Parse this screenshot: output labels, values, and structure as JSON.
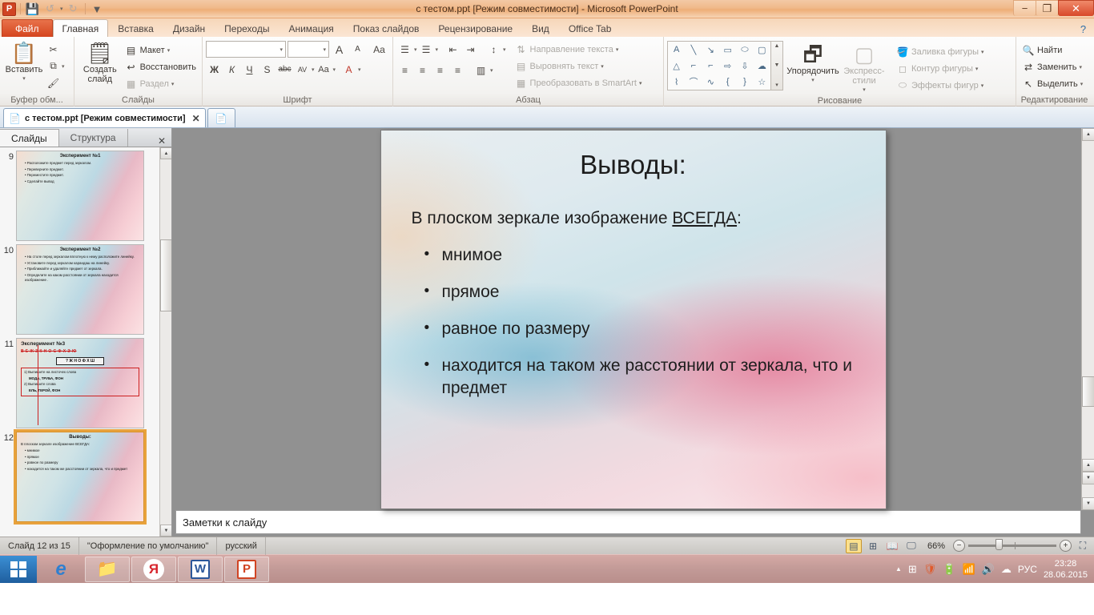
{
  "window": {
    "title": "с тестом.ppt [Режим совместимости]  -  Microsoft PowerPoint",
    "app_icon": "P",
    "minimize": "−",
    "restore": "❐",
    "close": "✕",
    "help": "?"
  },
  "quick_access": {
    "save": "💾",
    "undo": "↺",
    "redo": "↻",
    "customize": "▼"
  },
  "ribbon_tabs": [
    {
      "label": "Файл",
      "type": "file"
    },
    {
      "label": "Главная",
      "type": "active"
    },
    {
      "label": "Вставка",
      "type": "normal"
    },
    {
      "label": "Дизайн",
      "type": "normal"
    },
    {
      "label": "Переходы",
      "type": "normal"
    },
    {
      "label": "Анимация",
      "type": "normal"
    },
    {
      "label": "Показ слайдов",
      "type": "normal"
    },
    {
      "label": "Рецензирование",
      "type": "normal"
    },
    {
      "label": "Вид",
      "type": "normal"
    },
    {
      "label": "Office Tab",
      "type": "normal"
    }
  ],
  "ribbon": {
    "clipboard": {
      "label": "Буфер обм...",
      "paste": "Вставить",
      "cut_icon": "✂",
      "copy_icon": "⧉",
      "format_painter_icon": "🖌"
    },
    "slides": {
      "label": "Слайды",
      "new_slide": "Создать слайд",
      "layout": "Макет",
      "reset": "Восстановить",
      "section": "Раздел"
    },
    "font": {
      "label": "Шрифт",
      "font_name": "",
      "font_size": "",
      "grow": "A",
      "shrink": "A",
      "clear_format": "Aa",
      "bold": "Ж",
      "italic": "К",
      "underline": "Ч",
      "shadow": "S",
      "strikethrough": "abc",
      "spacing": "AV",
      "case": "Aa",
      "color": "A"
    },
    "paragraph": {
      "label": "Абзац",
      "bullets": "☰",
      "numbering": "☰",
      "decrease_indent": "⇤",
      "increase_indent": "⇥",
      "line_spacing": "↕",
      "text_direction": "Направление текста",
      "align_text": "Выровнять текст",
      "convert_smartart": "Преобразовать в SmartArt",
      "align_left": "≡",
      "align_center": "≡",
      "align_right": "≡",
      "justify": "≡",
      "columns": "▥"
    },
    "drawing": {
      "label": "Рисование",
      "shapes": [
        "A",
        "╲",
        "↘",
        "▭",
        "⬭",
        "▢",
        "△",
        "⌐",
        "⌐",
        "⇨",
        "⇩",
        "☁",
        "⌇",
        "⌒",
        "∿",
        "{",
        "}",
        "☆"
      ],
      "arrange": "Упорядочить",
      "quick_styles": "Экспресс-стили",
      "shape_fill": "Заливка фигуры",
      "shape_outline": "Контур фигуры",
      "shape_effects": "Эффекты фигур"
    },
    "editing": {
      "label": "Редактирование",
      "find": "Найти",
      "replace": "Заменить",
      "select": "Выделить"
    }
  },
  "office_tab_bar": {
    "document_tab": "с тестом.ppt [Режим совместимости]",
    "close": "✕",
    "new_tab_icon": "📄"
  },
  "slide_panel": {
    "tabs": [
      {
        "label": "Слайды",
        "active": true
      },
      {
        "label": "Структура",
        "active": false
      }
    ],
    "close": "✕",
    "thumbnails": [
      {
        "number": "9",
        "title": "Эксперимент №1",
        "lines": [
          "Расположите предмет перед зеркалом.",
          "Переверните предмет.",
          "Переместите предмет.",
          "Сделайте вывод"
        ],
        "selected": false
      },
      {
        "number": "10",
        "title": "Эксперимент №2",
        "lines": [
          "На столе перед зеркалом вплотную к нему расположите линейку.",
          "Установите перед зеркалом карандаш на линейку.",
          "Приближайте и удаляйте предмет от зеркала.",
          "Определите на каком расстоянии от зеркала находится изображение ."
        ],
        "selected": false
      },
      {
        "number": "11",
        "title": "Эксперимент №3",
        "lines": [
          "В Е Ж З К Н О С Ф Х Э Ю",
          "? Ж Н О Ф Х Ш",
          "1) Выпишите на листочек слова",
          "МОДА, ТРУБА, ФОН",
          "2) Выпишите слова",
          "ЕЛЬ, ГЕРОЙ, ФОН"
        ],
        "selected": false
      },
      {
        "number": "12",
        "title": "Выводы:",
        "lines": [
          "В плоском зеркале изображение ВСЕГДА:",
          "мнимое",
          "прямое",
          "равное по размеру",
          "находится на таком же расстоянии от зеркала, что и предмет"
        ],
        "selected": true
      }
    ]
  },
  "slide": {
    "title": "Выводы:",
    "lead_prefix": "В плоском зеркале изображение ",
    "lead_emphasis": "ВСЕГДА",
    "lead_suffix": ":",
    "bullets": [
      "мнимое",
      "прямое",
      "равное по размеру",
      "находится на таком же расстоянии от зеркала, что и предмет"
    ]
  },
  "notes": {
    "placeholder": "Заметки к слайду"
  },
  "status_bar": {
    "slide_count": "Слайд 12 из 15",
    "theme": "\"Оформление по умолчанию\"",
    "language": "русский",
    "zoom": "66%",
    "zoom_out": "−",
    "zoom_in": "+",
    "fit_icon": "⛶",
    "views": [
      {
        "icon": "▤",
        "name": "normal",
        "active": true
      },
      {
        "icon": "⊞",
        "name": "slide-sorter",
        "active": false
      },
      {
        "icon": "📖",
        "name": "reading",
        "active": false
      },
      {
        "icon": "🖵",
        "name": "slideshow",
        "active": false
      }
    ]
  },
  "taskbar": {
    "start": "⊞",
    "items": [
      {
        "name": "internet-explorer",
        "glyph": "e"
      },
      {
        "name": "file-explorer",
        "glyph": "📁"
      },
      {
        "name": "yandex-browser",
        "glyph": "Я"
      },
      {
        "name": "microsoft-word",
        "glyph": "W"
      },
      {
        "name": "microsoft-powerpoint",
        "glyph": "P"
      }
    ],
    "tray": {
      "expand": "▲",
      "icons": [
        "⊞",
        "🛡",
        "🔋",
        "📶",
        "🔊",
        "☁"
      ],
      "language": "РУС",
      "time": "23:28",
      "date": "28.06.2015"
    }
  }
}
